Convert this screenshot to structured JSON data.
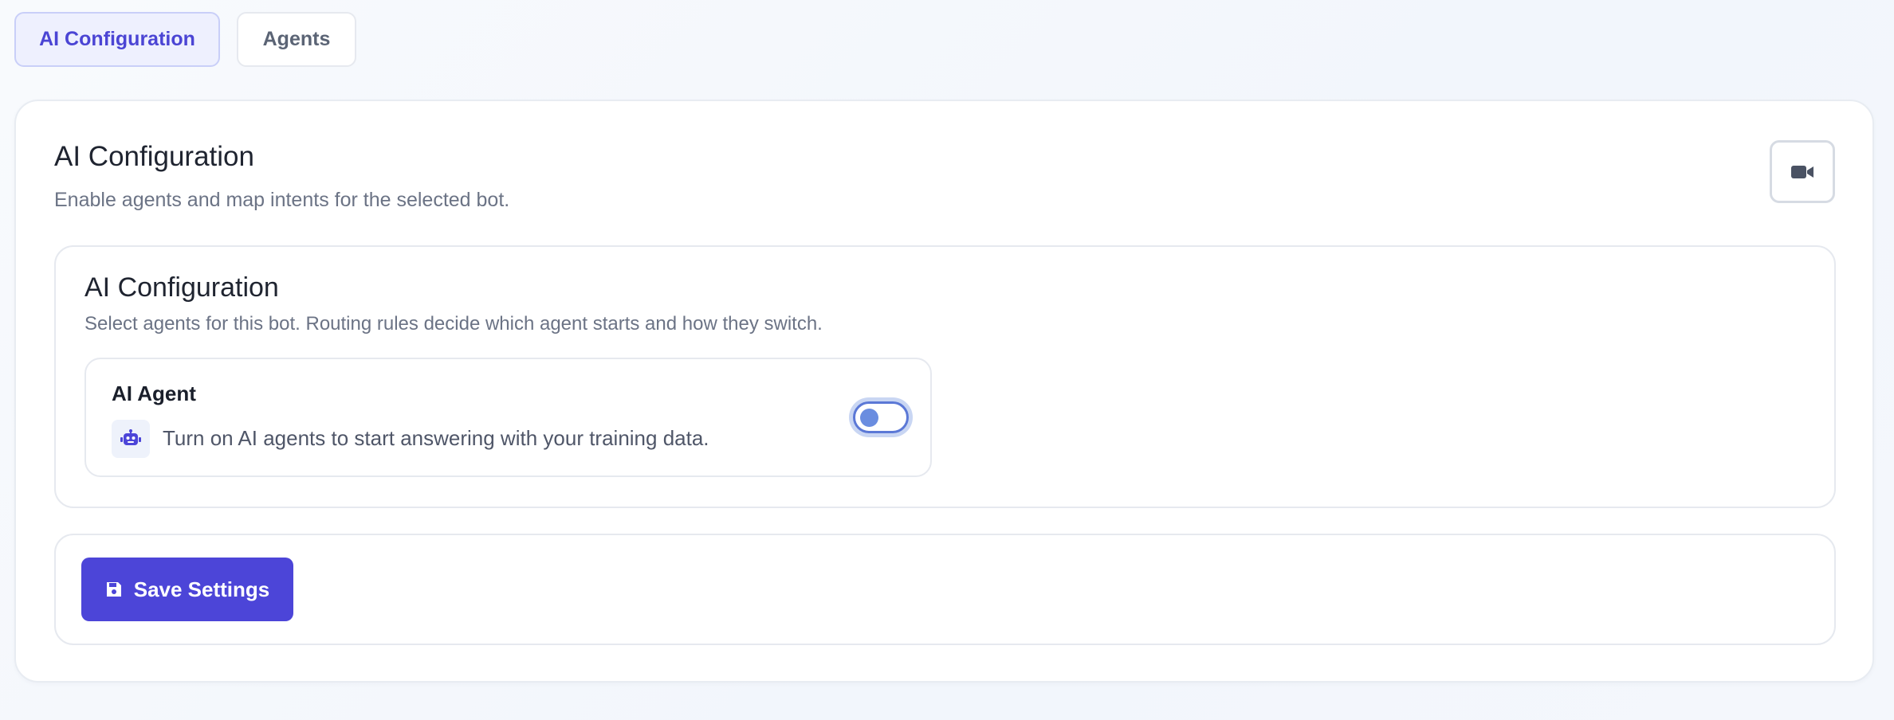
{
  "tabs": [
    {
      "label": "AI Configuration",
      "active": true
    },
    {
      "label": "Agents",
      "active": false
    }
  ],
  "header": {
    "title": "AI Configuration",
    "subtitle": "Enable agents and map intents for the selected bot.",
    "video_icon": "video-camera-icon"
  },
  "section": {
    "title": "AI Configuration",
    "subtitle": "Select agents for this bot. Routing rules decide which agent starts and how they switch."
  },
  "agent": {
    "title": "AI Agent",
    "description": "Turn on AI agents to start answering with your training data.",
    "icon": "robot-icon",
    "enabled": false
  },
  "footer": {
    "save_label": "Save Settings",
    "save_icon": "floppy-disk-icon"
  },
  "colors": {
    "accent": "#4c45d8",
    "tab_active_bg": "#eef0fe",
    "toggle_blue": "#5b78d6"
  }
}
